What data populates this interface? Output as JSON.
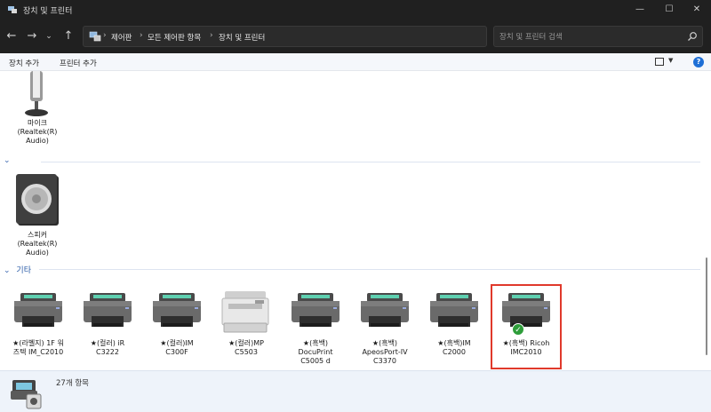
{
  "window": {
    "title": "장치 및 프린터",
    "controls": {
      "minimize": "—",
      "maximize": "☐",
      "close": "✕"
    }
  },
  "nav": {
    "back": "←",
    "forward": "→",
    "recent": "⌄",
    "up": "↑",
    "breadcrumb": [
      "제어판",
      "모든 제어판 항목",
      "장치 및 프린터"
    ],
    "separator": "›",
    "dropdown": "⌄",
    "refresh": "↻",
    "search_placeholder": "장치 및 프린터 검색"
  },
  "commands": {
    "add_device": "장치 추가",
    "add_printer": "프린터 추가"
  },
  "groups": {
    "speakers_header": "",
    "other_header": "기타"
  },
  "devices": {
    "microphone": "마이크\n(Realtek(R)\nAudio)",
    "speaker": "스피커\n(Realtek(R)\nAudio)"
  },
  "printers": [
    {
      "label": "★(라벨지) 1F 워\n즈텍 IM_C2010",
      "default": false,
      "selected": false,
      "kind": "generic"
    },
    {
      "label": "★(컬러) iR\nC3222",
      "default": false,
      "selected": false,
      "kind": "generic"
    },
    {
      "label": "★(컬러)IM\nC300F",
      "default": false,
      "selected": false,
      "kind": "generic"
    },
    {
      "label": "★(컬러)MP\nC5503",
      "default": false,
      "selected": false,
      "kind": "mfp"
    },
    {
      "label": "★(흑백)\nDocuPrint\nC5005 d",
      "default": false,
      "selected": false,
      "kind": "generic"
    },
    {
      "label": "★(흑백)\nApeosPort-IV\nC3370",
      "default": false,
      "selected": false,
      "kind": "generic"
    },
    {
      "label": "★(흑백)IM\nC2000",
      "default": false,
      "selected": false,
      "kind": "generic"
    },
    {
      "label": "★(흑백) Ricoh\nIMC2010",
      "default": true,
      "selected": true,
      "kind": "generic"
    }
  ],
  "status": {
    "count_text": "27개 항목"
  },
  "colors": {
    "title_bar": "#202020",
    "selection_outline": "#e0392b",
    "default_check": "#2e9d3a",
    "group_header": "#2b5ca8",
    "status_bar": "#eef3fa"
  }
}
